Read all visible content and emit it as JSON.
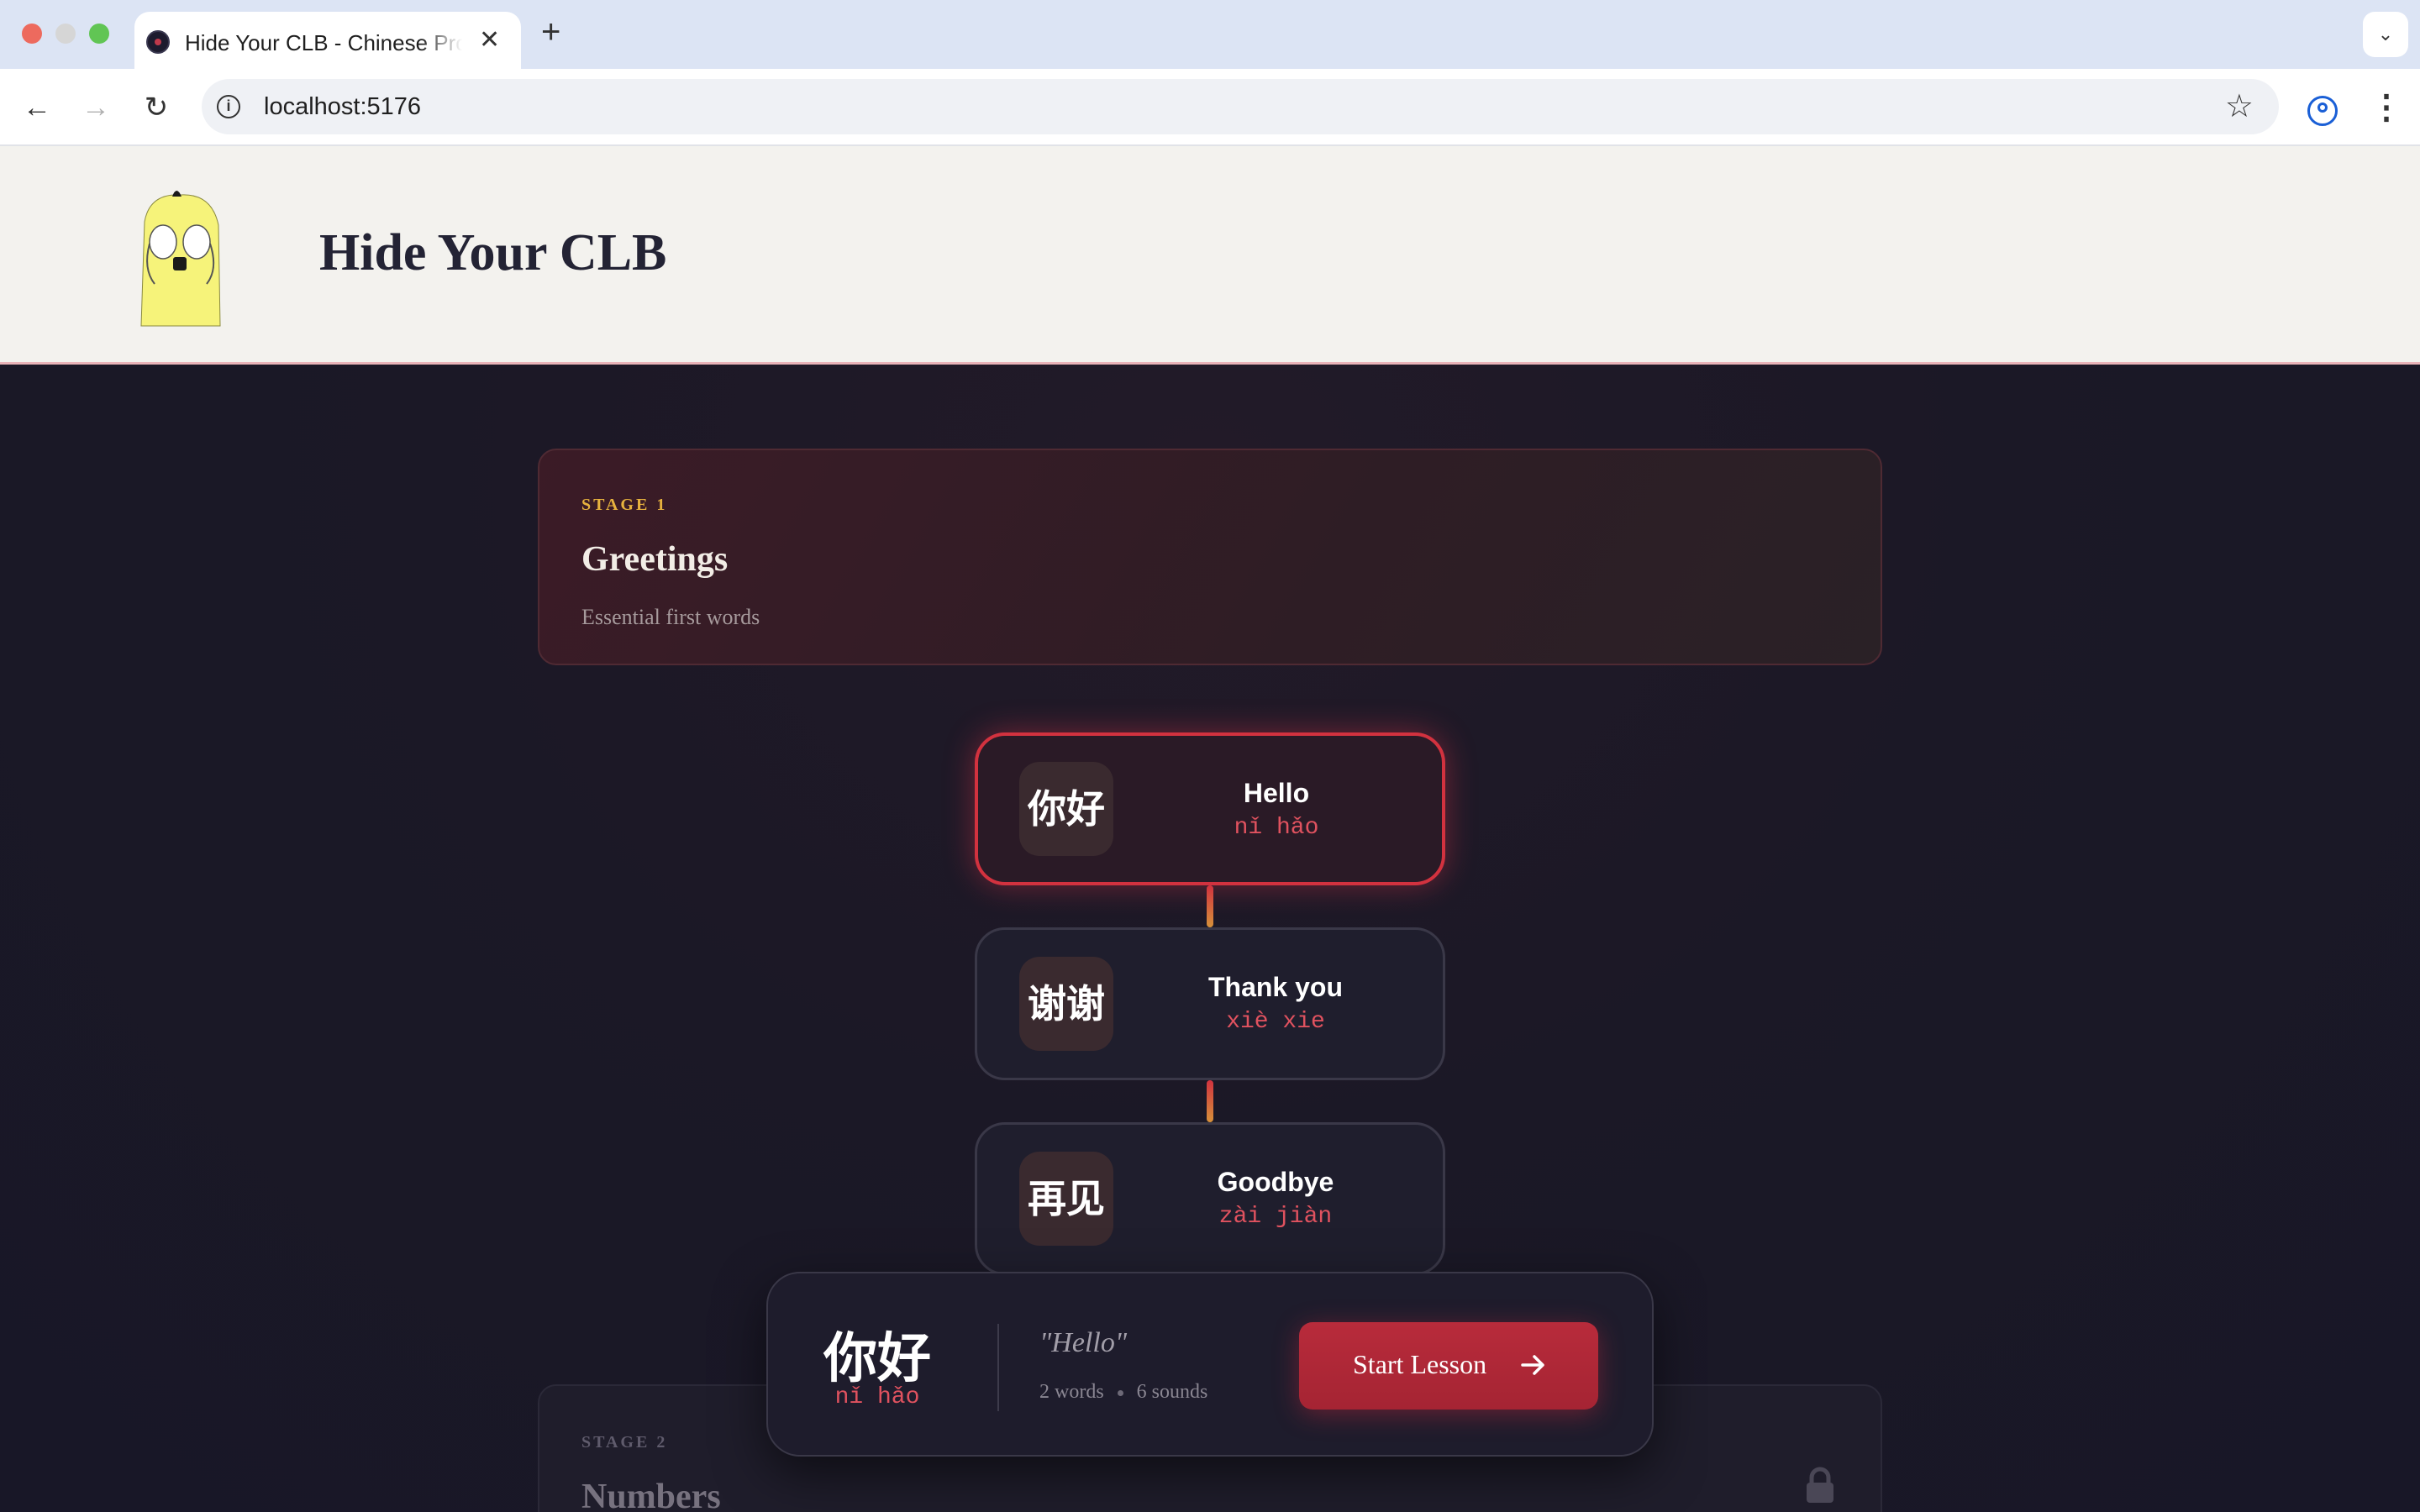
{
  "browser": {
    "tab_title": "Hide Your CLB - Chinese Pronunciation",
    "url": "localhost:5176",
    "icons": {
      "back": "arrow-left-icon",
      "forward": "arrow-right-icon",
      "reload": "reload-icon",
      "info": "info-icon",
      "bookmark": "star-icon",
      "profile": "profile-icon",
      "menu": "kebab-menu-icon",
      "new_tab": "plus-icon",
      "close_tab": "close-icon",
      "tab_list": "chevron-down-icon"
    }
  },
  "header": {
    "title": "Hide Your CLB",
    "mascot": "yellow-mascot-covering-eyes"
  },
  "stages": [
    {
      "label": "STAGE 1",
      "name": "Greetings",
      "description": "Essential first words",
      "locked": false,
      "words": [
        {
          "hanzi": "你好",
          "english": "Hello",
          "pinyin": "nǐ hǎo",
          "active": true
        },
        {
          "hanzi": "谢谢",
          "english": "Thank you",
          "pinyin": "xiè xie",
          "active": false
        },
        {
          "hanzi": "再见",
          "english": "Goodbye",
          "pinyin": "zài jiàn",
          "active": false
        }
      ]
    },
    {
      "label": "STAGE 2",
      "name": "Numbers",
      "locked": true
    }
  ],
  "lesson_bar": {
    "hanzi": "你好",
    "pinyin": "nǐ hǎo",
    "quote": "\"Hello\"",
    "words": "2 words",
    "sounds": "6 sounds",
    "button_label": "Start Lesson"
  },
  "colors": {
    "accent_red": "#d2323f",
    "pinyin_red": "#e0525f",
    "stage_gold": "#e7b23e",
    "background": "#1a1826",
    "header_bg": "#f3f2ee"
  }
}
